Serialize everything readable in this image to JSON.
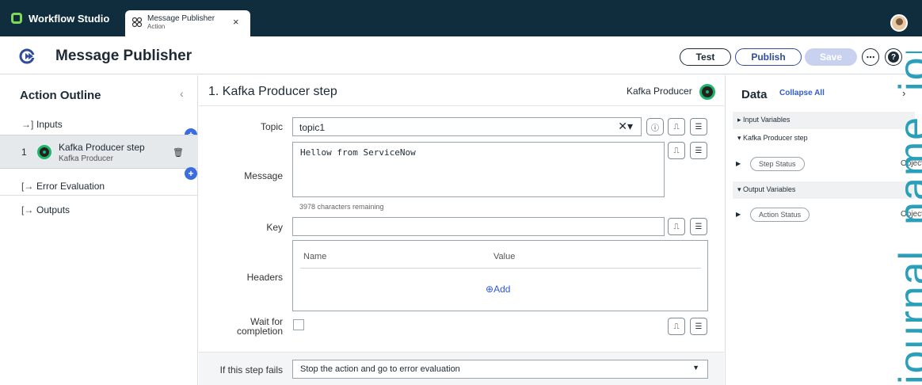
{
  "topbar": {
    "app_name": "Workflow Studio",
    "tab_title": "Message Publisher",
    "tab_subtitle": "Action",
    "tab_close": "×"
  },
  "header": {
    "title": "Message Publisher",
    "buttons": {
      "test": "Test",
      "publish": "Publish",
      "save": "Save",
      "more": "⋯",
      "help": "?"
    }
  },
  "outline": {
    "title": "Action Outline",
    "collapse": "‹",
    "inputs_label": "Inputs",
    "step": {
      "number": "1",
      "title": "Kafka Producer step",
      "subtitle": "Kafka Producer"
    },
    "error_label": "Error Evaluation",
    "outputs_label": "Outputs",
    "add_symbol": "+"
  },
  "step_config": {
    "title": "1.  Kafka Producer step",
    "type": "Kafka Producer",
    "topic": {
      "label": "Topic",
      "value": "topic1"
    },
    "message": {
      "label": "Message",
      "value": "Hellow from ServiceNow",
      "remaining": "3978 characters remaining"
    },
    "key": {
      "label": "Key",
      "value": ""
    },
    "headers": {
      "label": "Headers",
      "col_name": "Name",
      "col_value": "Value",
      "add_label": "Add"
    },
    "wait": {
      "label_line1": "Wait for",
      "label_line2": "completion"
    },
    "fail": {
      "label": "If this step fails",
      "value": "Stop the action and go to error evaluation"
    }
  },
  "data_panel": {
    "title": "Data",
    "collapse_all": "Collapse All",
    "sections": {
      "input_variables": "Input Variables",
      "kafka_step": "Kafka Producer step",
      "output_variables": "Output Variables"
    },
    "step_status": {
      "pill": "Step Status",
      "type": "Object"
    },
    "action_status": {
      "pill": "Action Status",
      "type": "Object"
    }
  },
  "watermark": "journal_name_journal",
  "colors": {
    "topbar": "#0f2d3d",
    "accent_green": "#1db56a",
    "link_blue": "#2f5bd3",
    "publish_blue": "#2f4c9e",
    "save_disabled": "#c8d2ef"
  },
  "icons": {
    "app": "servicenow-logo-icon",
    "tab": "action-icon",
    "header": "action-arrow-icon",
    "info": "info-icon",
    "pill": "data-pill-icon",
    "picker": "data-picker-icon",
    "trash": "trash-icon"
  }
}
